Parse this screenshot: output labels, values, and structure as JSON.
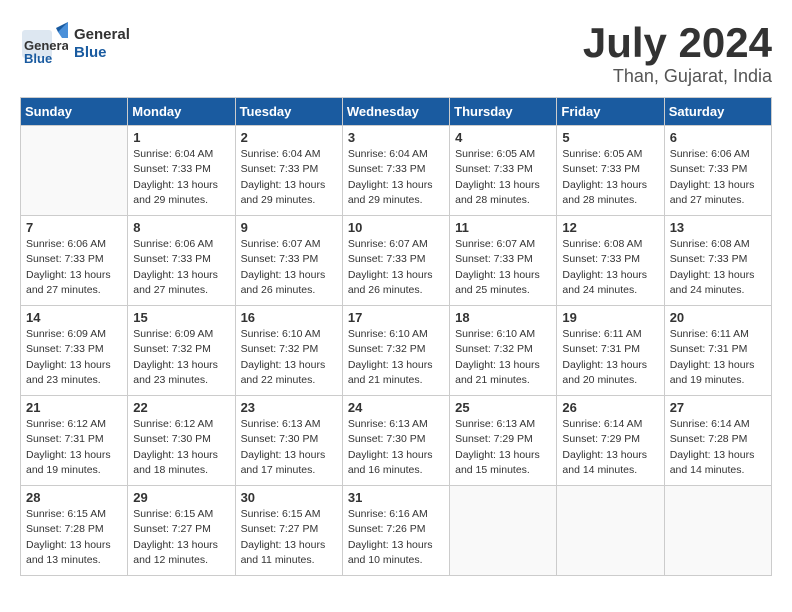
{
  "header": {
    "logo_general": "General",
    "logo_blue": "Blue",
    "month_year": "July 2024",
    "location": "Than, Gujarat, India"
  },
  "days_of_week": [
    "Sunday",
    "Monday",
    "Tuesday",
    "Wednesday",
    "Thursday",
    "Friday",
    "Saturday"
  ],
  "weeks": [
    [
      {
        "day": "",
        "sunrise": "",
        "sunset": "",
        "daylight": ""
      },
      {
        "day": "1",
        "sunrise": "Sunrise: 6:04 AM",
        "sunset": "Sunset: 7:33 PM",
        "daylight": "Daylight: 13 hours and 29 minutes."
      },
      {
        "day": "2",
        "sunrise": "Sunrise: 6:04 AM",
        "sunset": "Sunset: 7:33 PM",
        "daylight": "Daylight: 13 hours and 29 minutes."
      },
      {
        "day": "3",
        "sunrise": "Sunrise: 6:04 AM",
        "sunset": "Sunset: 7:33 PM",
        "daylight": "Daylight: 13 hours and 29 minutes."
      },
      {
        "day": "4",
        "sunrise": "Sunrise: 6:05 AM",
        "sunset": "Sunset: 7:33 PM",
        "daylight": "Daylight: 13 hours and 28 minutes."
      },
      {
        "day": "5",
        "sunrise": "Sunrise: 6:05 AM",
        "sunset": "Sunset: 7:33 PM",
        "daylight": "Daylight: 13 hours and 28 minutes."
      },
      {
        "day": "6",
        "sunrise": "Sunrise: 6:06 AM",
        "sunset": "Sunset: 7:33 PM",
        "daylight": "Daylight: 13 hours and 27 minutes."
      }
    ],
    [
      {
        "day": "7",
        "sunrise": "Sunrise: 6:06 AM",
        "sunset": "Sunset: 7:33 PM",
        "daylight": "Daylight: 13 hours and 27 minutes."
      },
      {
        "day": "8",
        "sunrise": "Sunrise: 6:06 AM",
        "sunset": "Sunset: 7:33 PM",
        "daylight": "Daylight: 13 hours and 27 minutes."
      },
      {
        "day": "9",
        "sunrise": "Sunrise: 6:07 AM",
        "sunset": "Sunset: 7:33 PM",
        "daylight": "Daylight: 13 hours and 26 minutes."
      },
      {
        "day": "10",
        "sunrise": "Sunrise: 6:07 AM",
        "sunset": "Sunset: 7:33 PM",
        "daylight": "Daylight: 13 hours and 26 minutes."
      },
      {
        "day": "11",
        "sunrise": "Sunrise: 6:07 AM",
        "sunset": "Sunset: 7:33 PM",
        "daylight": "Daylight: 13 hours and 25 minutes."
      },
      {
        "day": "12",
        "sunrise": "Sunrise: 6:08 AM",
        "sunset": "Sunset: 7:33 PM",
        "daylight": "Daylight: 13 hours and 24 minutes."
      },
      {
        "day": "13",
        "sunrise": "Sunrise: 6:08 AM",
        "sunset": "Sunset: 7:33 PM",
        "daylight": "Daylight: 13 hours and 24 minutes."
      }
    ],
    [
      {
        "day": "14",
        "sunrise": "Sunrise: 6:09 AM",
        "sunset": "Sunset: 7:33 PM",
        "daylight": "Daylight: 13 hours and 23 minutes."
      },
      {
        "day": "15",
        "sunrise": "Sunrise: 6:09 AM",
        "sunset": "Sunset: 7:32 PM",
        "daylight": "Daylight: 13 hours and 23 minutes."
      },
      {
        "day": "16",
        "sunrise": "Sunrise: 6:10 AM",
        "sunset": "Sunset: 7:32 PM",
        "daylight": "Daylight: 13 hours and 22 minutes."
      },
      {
        "day": "17",
        "sunrise": "Sunrise: 6:10 AM",
        "sunset": "Sunset: 7:32 PM",
        "daylight": "Daylight: 13 hours and 21 minutes."
      },
      {
        "day": "18",
        "sunrise": "Sunrise: 6:10 AM",
        "sunset": "Sunset: 7:32 PM",
        "daylight": "Daylight: 13 hours and 21 minutes."
      },
      {
        "day": "19",
        "sunrise": "Sunrise: 6:11 AM",
        "sunset": "Sunset: 7:31 PM",
        "daylight": "Daylight: 13 hours and 20 minutes."
      },
      {
        "day": "20",
        "sunrise": "Sunrise: 6:11 AM",
        "sunset": "Sunset: 7:31 PM",
        "daylight": "Daylight: 13 hours and 19 minutes."
      }
    ],
    [
      {
        "day": "21",
        "sunrise": "Sunrise: 6:12 AM",
        "sunset": "Sunset: 7:31 PM",
        "daylight": "Daylight: 13 hours and 19 minutes."
      },
      {
        "day": "22",
        "sunrise": "Sunrise: 6:12 AM",
        "sunset": "Sunset: 7:30 PM",
        "daylight": "Daylight: 13 hours and 18 minutes."
      },
      {
        "day": "23",
        "sunrise": "Sunrise: 6:13 AM",
        "sunset": "Sunset: 7:30 PM",
        "daylight": "Daylight: 13 hours and 17 minutes."
      },
      {
        "day": "24",
        "sunrise": "Sunrise: 6:13 AM",
        "sunset": "Sunset: 7:30 PM",
        "daylight": "Daylight: 13 hours and 16 minutes."
      },
      {
        "day": "25",
        "sunrise": "Sunrise: 6:13 AM",
        "sunset": "Sunset: 7:29 PM",
        "daylight": "Daylight: 13 hours and 15 minutes."
      },
      {
        "day": "26",
        "sunrise": "Sunrise: 6:14 AM",
        "sunset": "Sunset: 7:29 PM",
        "daylight": "Daylight: 13 hours and 14 minutes."
      },
      {
        "day": "27",
        "sunrise": "Sunrise: 6:14 AM",
        "sunset": "Sunset: 7:28 PM",
        "daylight": "Daylight: 13 hours and 14 minutes."
      }
    ],
    [
      {
        "day": "28",
        "sunrise": "Sunrise: 6:15 AM",
        "sunset": "Sunset: 7:28 PM",
        "daylight": "Daylight: 13 hours and 13 minutes."
      },
      {
        "day": "29",
        "sunrise": "Sunrise: 6:15 AM",
        "sunset": "Sunset: 7:27 PM",
        "daylight": "Daylight: 13 hours and 12 minutes."
      },
      {
        "day": "30",
        "sunrise": "Sunrise: 6:15 AM",
        "sunset": "Sunset: 7:27 PM",
        "daylight": "Daylight: 13 hours and 11 minutes."
      },
      {
        "day": "31",
        "sunrise": "Sunrise: 6:16 AM",
        "sunset": "Sunset: 7:26 PM",
        "daylight": "Daylight: 13 hours and 10 minutes."
      },
      {
        "day": "",
        "sunrise": "",
        "sunset": "",
        "daylight": ""
      },
      {
        "day": "",
        "sunrise": "",
        "sunset": "",
        "daylight": ""
      },
      {
        "day": "",
        "sunrise": "",
        "sunset": "",
        "daylight": ""
      }
    ]
  ]
}
